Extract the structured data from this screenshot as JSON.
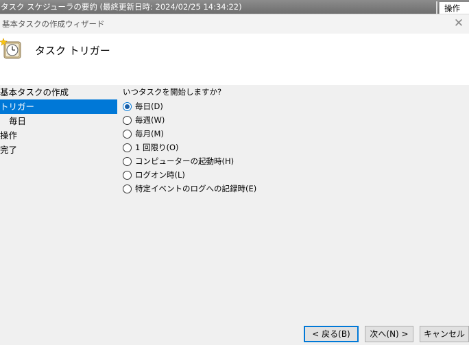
{
  "background": {
    "strip_text": "タスク スケジューラの要約 (最終更新日時: 2024/02/25 14:34:22)",
    "ops_label": "操作"
  },
  "wizard": {
    "title": "基本タスクの作成ウィザード",
    "heading": "タスク トリガー",
    "icon": "task-clock-icon"
  },
  "nav": {
    "items": [
      {
        "label": "基本タスクの作成"
      },
      {
        "label": "トリガー"
      },
      {
        "label": "毎日"
      },
      {
        "label": "操作"
      },
      {
        "label": "完了"
      }
    ]
  },
  "trigger": {
    "question": "いつタスクを開始しますか?",
    "options": [
      {
        "label": "毎日(D)",
        "checked": true
      },
      {
        "label": "毎週(W)"
      },
      {
        "label": "毎月(M)"
      },
      {
        "label": "1 回限り(O)"
      },
      {
        "label": "コンピューターの起動時(H)"
      },
      {
        "label": "ログオン時(L)"
      },
      {
        "label": "特定イベントのログへの記録時(E)"
      }
    ]
  },
  "buttons": {
    "back": "< 戻る(B)",
    "next": "次へ(N) >",
    "cancel": "キャンセル"
  },
  "colors": {
    "selection": "#0078d7",
    "window_bg": "#f0f0f0",
    "header_bg": "#ffffff"
  }
}
